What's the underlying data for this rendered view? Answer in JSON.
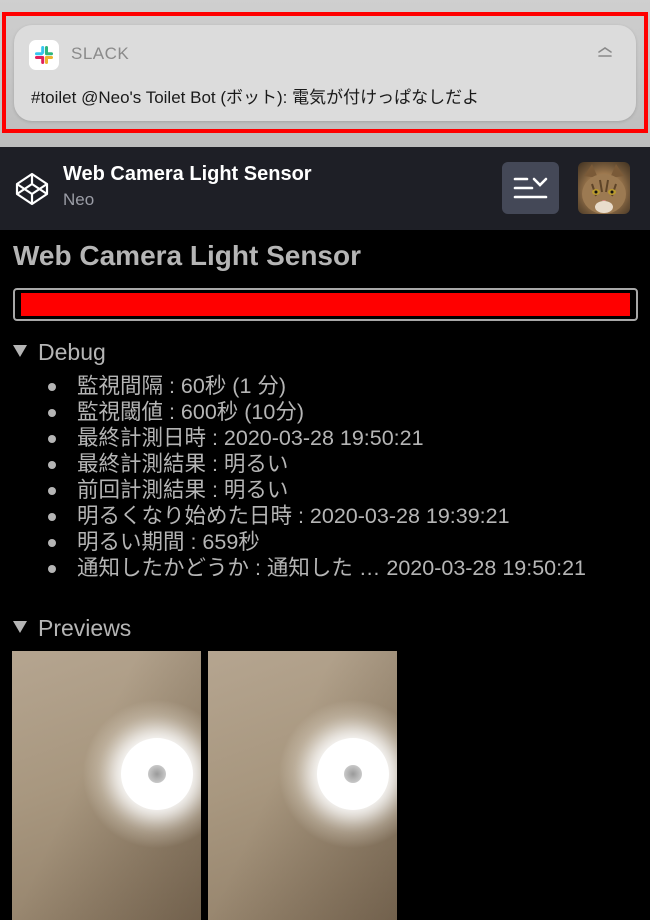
{
  "notification": {
    "app_name": "SLACK",
    "message": "#toilet @Neo's Toilet Bot (ボット): 電気が付けっぱなしだよ",
    "app_icon": "slack-icon",
    "action_icon": "expand-chevron-icon",
    "highlight_color": "#ff0000"
  },
  "pen_header": {
    "title": "Web Camera Light Sensor",
    "author": "Neo",
    "logo_icon": "codepen-logo",
    "menu_icon": "menu-collapse-icon",
    "avatar_icon": "cat-avatar"
  },
  "page": {
    "title": "Web Camera Light Sensor",
    "meter": {
      "level": 1.0,
      "color": "#ff0000"
    },
    "debug": {
      "summary": "Debug",
      "items": [
        "監視間隔 : 60秒 (1 分)",
        "監視閾値 : 600秒 (10分)",
        "最終計測日時 : 2020-03-28 19:50:21",
        "最終計測結果 : 明るい",
        "前回計測結果 : 明るい",
        "明るくなり始めた日時 : 2020-03-28 19:39:21",
        "明るい期間 : 659秒",
        "通知したかどうか : 通知した … 2020-03-28 19:50:21"
      ]
    },
    "previews": {
      "summary": "Previews",
      "count": 2
    }
  }
}
